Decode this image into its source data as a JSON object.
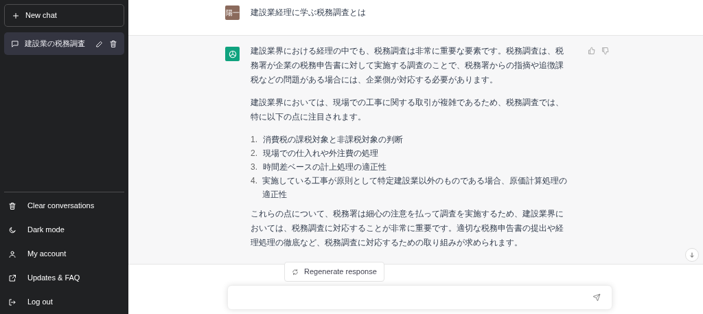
{
  "sidebar": {
    "new_chat": "New chat",
    "conversations": [
      {
        "title": "建設業の税務調査",
        "selected": true
      }
    ],
    "menu": [
      {
        "kind": "trash",
        "label": "Clear conversations"
      },
      {
        "kind": "moon",
        "label": "Dark mode"
      },
      {
        "kind": "user",
        "label": "My account"
      },
      {
        "kind": "external",
        "label": "Updates & FAQ"
      },
      {
        "kind": "logout",
        "label": "Log out"
      }
    ]
  },
  "messages": [
    {
      "kind": "user",
      "avatar": "陽一",
      "paragraphs": [
        "建設業経理に学ぶ税務調査とは"
      ]
    },
    {
      "kind": "assistant",
      "paragraphs": [
        "建設業界における経理の中でも、税務調査は非常に重要な要素です。税務調査は、税務署が企業の税務申告書に対して実施する調査のことで、税務署からの指摘や追徴課税などの問題がある場合には、企業側が対応する必要があります。",
        "建設業界においては、現場での工事に関する取引が複雑であるため、税務調査では、特に以下の点に注目されます。"
      ],
      "list": [
        {
          "number": "1.",
          "text": "消費税の課税対象と非課税対象の判断"
        },
        {
          "number": "2.",
          "text": "現場での仕入れや外注費の処理"
        },
        {
          "number": "3.",
          "text": "時間差ベースの計上処理の適正性"
        },
        {
          "number": "4.",
          "text": "実施している工事が原則として特定建設業以外のものである場合、原価計算処理の適正性"
        }
      ],
      "closing": "これらの点について、税務署は細心の注意を払って調査を実施するため、建設業界においては、税務調査に対応することが非常に重要です。適切な税務申告書の提出や経理処理の徹底など、税務調査に対応するための取り組みが求められます。"
    }
  ],
  "regenerate": "Regenerate response"
}
